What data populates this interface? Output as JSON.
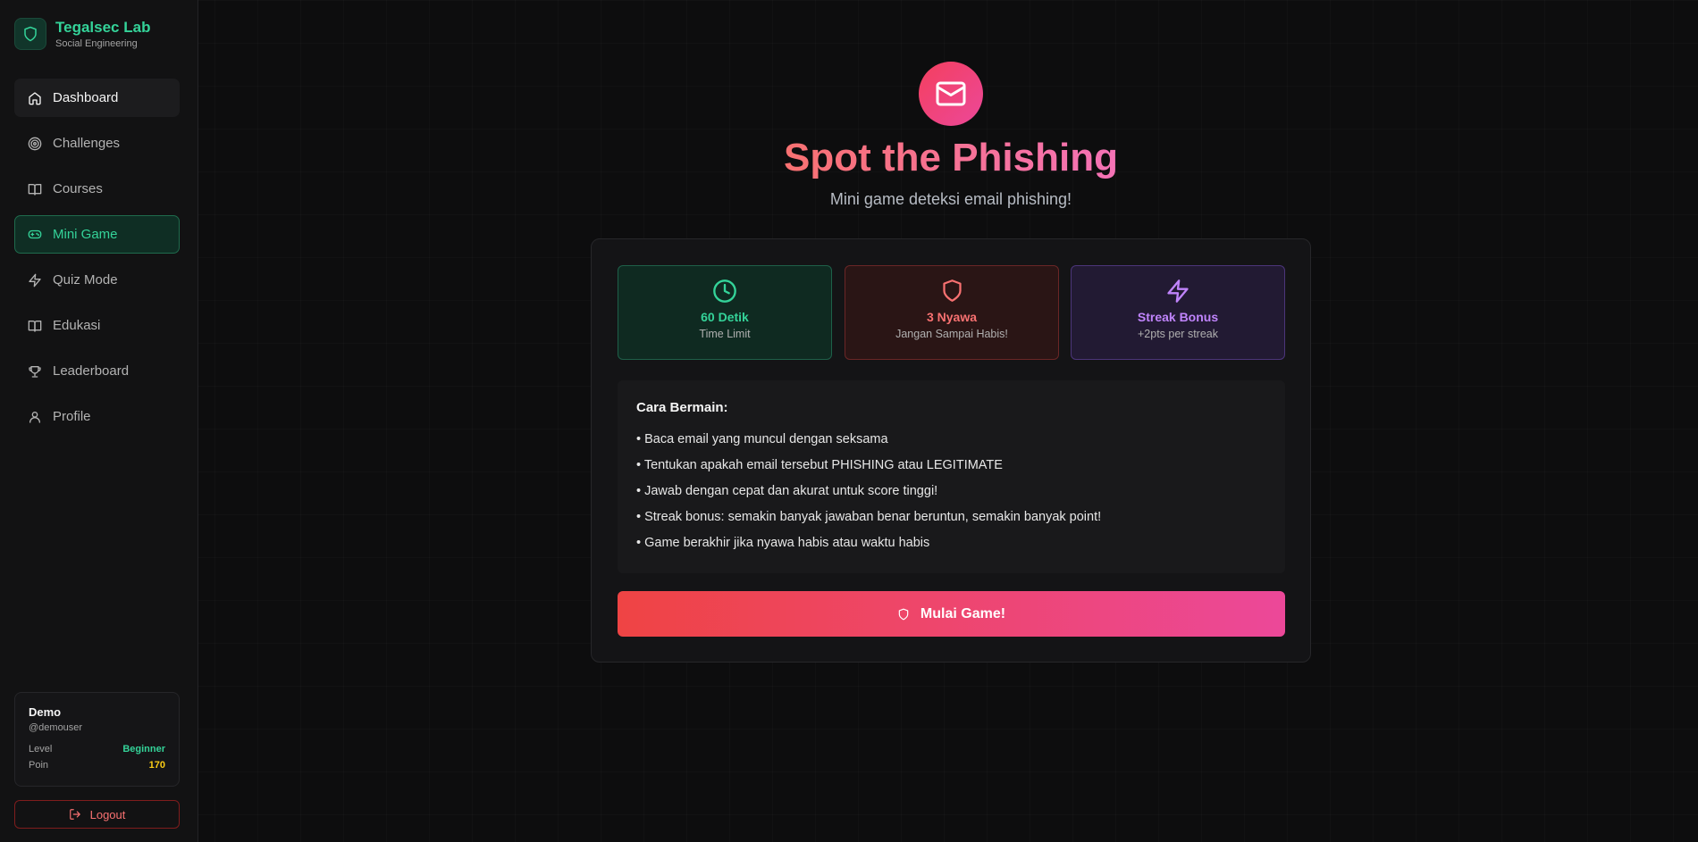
{
  "brand": {
    "title": "Tegalsec Lab",
    "subtitle": "Social Engineering",
    "icon": "shield-icon"
  },
  "nav": [
    {
      "label": "Dashboard",
      "icon": "home-icon",
      "state": "hover"
    },
    {
      "label": "Challenges",
      "icon": "target-icon",
      "state": "normal"
    },
    {
      "label": "Courses",
      "icon": "book-icon",
      "state": "normal"
    },
    {
      "label": "Mini Game",
      "icon": "gamepad-icon",
      "state": "active"
    },
    {
      "label": "Quiz Mode",
      "icon": "lightning-icon",
      "state": "normal"
    },
    {
      "label": "Edukasi",
      "icon": "book-open-icon",
      "state": "normal"
    },
    {
      "label": "Leaderboard",
      "icon": "trophy-icon",
      "state": "normal"
    },
    {
      "label": "Profile",
      "icon": "user-icon",
      "state": "normal"
    }
  ],
  "user": {
    "name": "Demo",
    "handle": "@demouser",
    "level_label": "Level",
    "level_value": "Beginner",
    "points_label": "Poin",
    "points_value": "170"
  },
  "logout_label": "Logout",
  "hero": {
    "icon": "mail-icon",
    "title": "Spot the Phishing",
    "subtitle": "Mini game deteksi email phishing!"
  },
  "stats": [
    {
      "title": "60 Detik",
      "subtitle": "Time Limit",
      "icon": "clock-icon"
    },
    {
      "title": "3 Nyawa",
      "subtitle": "Jangan Sampai Habis!",
      "icon": "shield-icon"
    },
    {
      "title": "Streak Bonus",
      "subtitle": "+2pts per streak",
      "icon": "lightning-icon"
    }
  ],
  "howto": {
    "title": "Cara Bermain:",
    "lines": [
      "• Baca email yang muncul dengan seksama",
      "• Tentukan apakah email tersebut PHISHING atau LEGITIMATE",
      "• Jawab dengan cepat dan akurat untuk score tinggi!",
      "• Streak bonus: semakin banyak jawaban benar beruntun, semakin banyak point!",
      "• Game berakhir jika nyawa habis atau waktu habis"
    ]
  },
  "start_button": {
    "label": "Mulai Game!",
    "icon": "shield-icon"
  },
  "colors": {
    "accent_green": "#34d399",
    "accent_red": "#f87171",
    "accent_purple": "#c084fc",
    "accent_yellow": "#facc15",
    "button_gradient_start": "#ef4444",
    "button_gradient_end": "#ec4899"
  }
}
